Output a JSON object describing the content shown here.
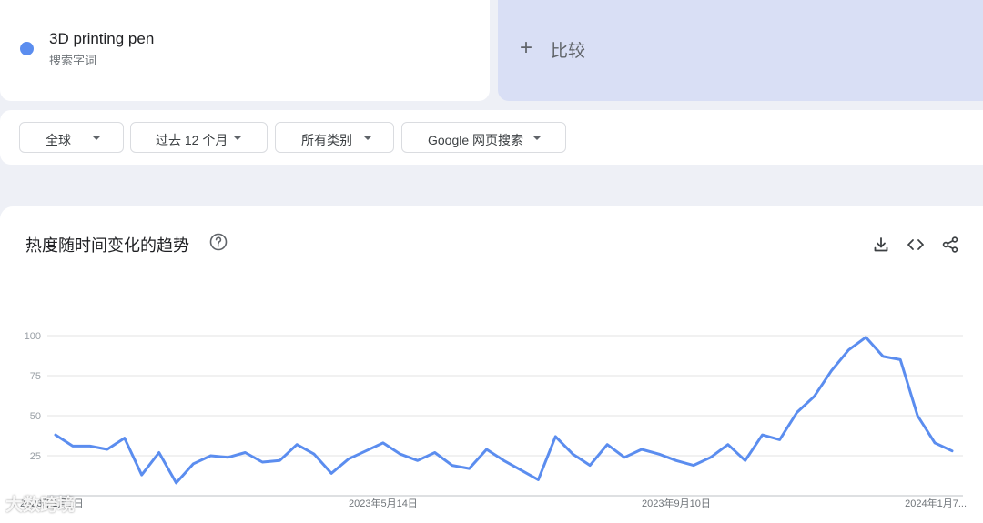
{
  "term": {
    "name": "3D printing pen",
    "subtitle": "搜索字词",
    "color": "#5b8def"
  },
  "compare": {
    "plus": "+",
    "label": "比较"
  },
  "filters": {
    "region": "全球",
    "time_range": "过去 12 个月",
    "category": "所有类别",
    "search_type": "Google 网页搜索"
  },
  "chart": {
    "title": "热度随时间变化的趋势",
    "icons": [
      "help-icon",
      "download-icon",
      "embed-icon",
      "share-icon"
    ]
  },
  "watermark": "大数跨境",
  "chart_data": {
    "type": "line",
    "ylim": [
      0,
      100
    ],
    "yticks": [
      25,
      50,
      75,
      100
    ],
    "grid": true,
    "xtick_labels": [
      "2023年1月1日",
      "2023年5月14日",
      "2023年9月10日",
      "2024年1月7..."
    ],
    "series": [
      {
        "name": "3D printing pen",
        "color": "#5b8def",
        "values": [
          38,
          31,
          31,
          29,
          36,
          13,
          27,
          8,
          20,
          25,
          24,
          27,
          21,
          22,
          32,
          26,
          14,
          23,
          28,
          33,
          26,
          22,
          27,
          19,
          17,
          29,
          22,
          16,
          10,
          37,
          26,
          19,
          32,
          24,
          29,
          26,
          22,
          19,
          24,
          32,
          22,
          38,
          35,
          52,
          62,
          78,
          91,
          99,
          87,
          85,
          50,
          33,
          28
        ]
      }
    ]
  }
}
